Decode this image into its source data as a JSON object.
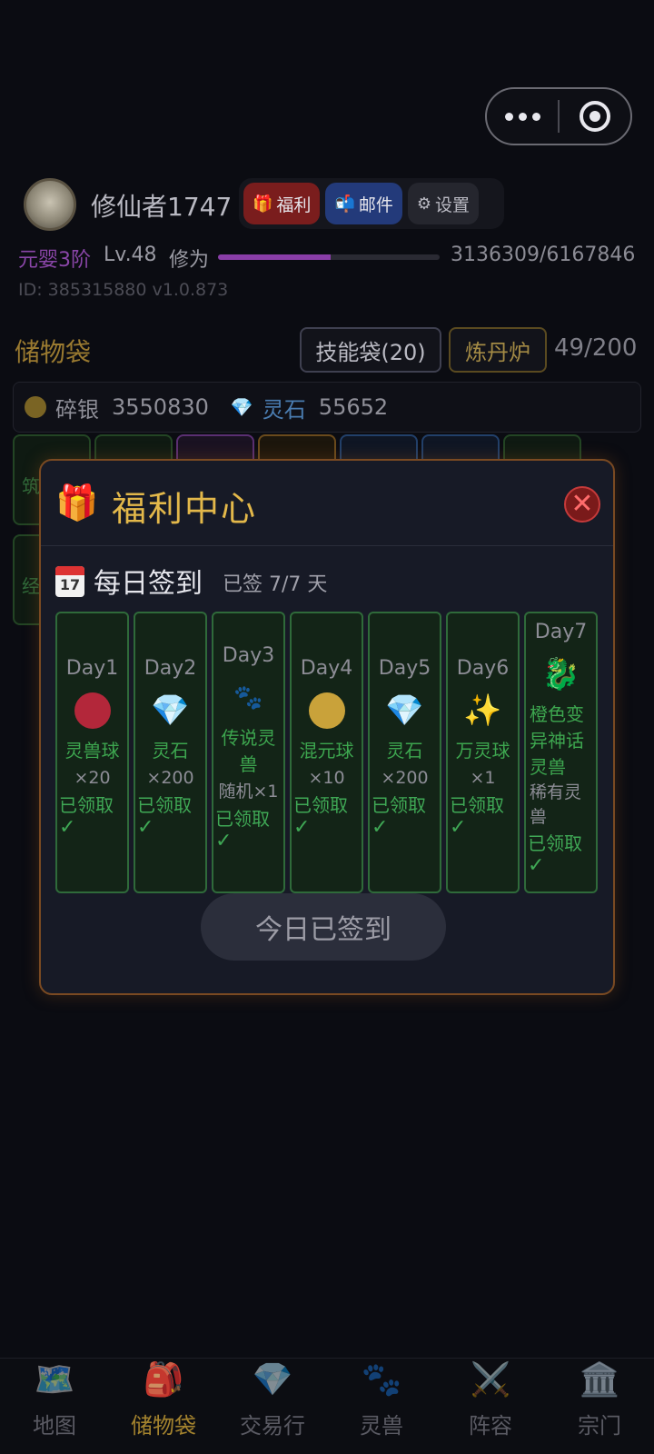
{
  "capsule": {
    "more_icon": "more-dots-icon",
    "target_icon": "target-circle-icon"
  },
  "header": {
    "username": "修仙者1747",
    "buttons": {
      "welfare": "福利",
      "mail": "邮件",
      "settings": "设置"
    },
    "realm": "元婴3阶",
    "level": "Lv.48",
    "xiuwei_label": "修为",
    "xp_progress": 0.5088,
    "xp_text": "3136309/6167846",
    "id_text": "ID: 385315880  v1.0.873"
  },
  "bag": {
    "title": "储物袋",
    "skill_bag": "技能袋(20)",
    "alchemy": "炼丹炉",
    "capacity": "49/200",
    "silver_label": "碎银",
    "silver_value": "3550830",
    "stone_label": "灵石",
    "stone_value": "55652",
    "slot_labels": [
      "筑",
      "经"
    ]
  },
  "modal": {
    "title": "福利中心",
    "calendar_icon_text": "17",
    "sign_title": "每日签到",
    "sign_status": "已签 7/7 天",
    "days": [
      {
        "name": "Day1",
        "icon": "red-ball-icon",
        "color": "#b3273a",
        "prize": "灵兽球",
        "qty": "×20",
        "status": "已领取",
        "check": "✓"
      },
      {
        "name": "Day2",
        "icon": "diamond-icon",
        "prize": "灵石",
        "qty": "×200",
        "status": "已领取",
        "check": "✓"
      },
      {
        "name": "Day3",
        "icon": "paw-icon",
        "prize": "传说灵兽",
        "qty": "随机×1",
        "status": "已领取",
        "check": "✓"
      },
      {
        "name": "Day4",
        "icon": "gold-ball-icon",
        "color": "#c9a23a",
        "prize": "混元球",
        "qty": "×10",
        "status": "已领取",
        "check": "✓"
      },
      {
        "name": "Day5",
        "icon": "diamond-icon",
        "prize": "灵石",
        "qty": "×200",
        "status": "已领取",
        "check": "✓"
      },
      {
        "name": "Day6",
        "icon": "sparkles-icon",
        "prize": "万灵球",
        "qty": "×1",
        "status": "已领取",
        "check": "✓"
      },
      {
        "name": "Day7",
        "icon": "dragon-icon",
        "prize": "橙色变异神话灵兽",
        "qty": "稀有灵兽",
        "status": "已领取",
        "check": "✓"
      }
    ],
    "signed_button": "今日已签到"
  },
  "nav": [
    {
      "label": "地图",
      "icon": "map-icon",
      "glyph": "🗺️"
    },
    {
      "label": "储物袋",
      "icon": "backpack-icon",
      "glyph": "🎒",
      "active": true
    },
    {
      "label": "交易行",
      "icon": "diamond-icon",
      "glyph": "💎"
    },
    {
      "label": "灵兽",
      "icon": "paw-icon",
      "glyph": "🐾"
    },
    {
      "label": "阵容",
      "icon": "crossed-swords-icon",
      "glyph": "⚔️"
    },
    {
      "label": "宗门",
      "icon": "temple-icon",
      "glyph": "🏛️"
    }
  ]
}
